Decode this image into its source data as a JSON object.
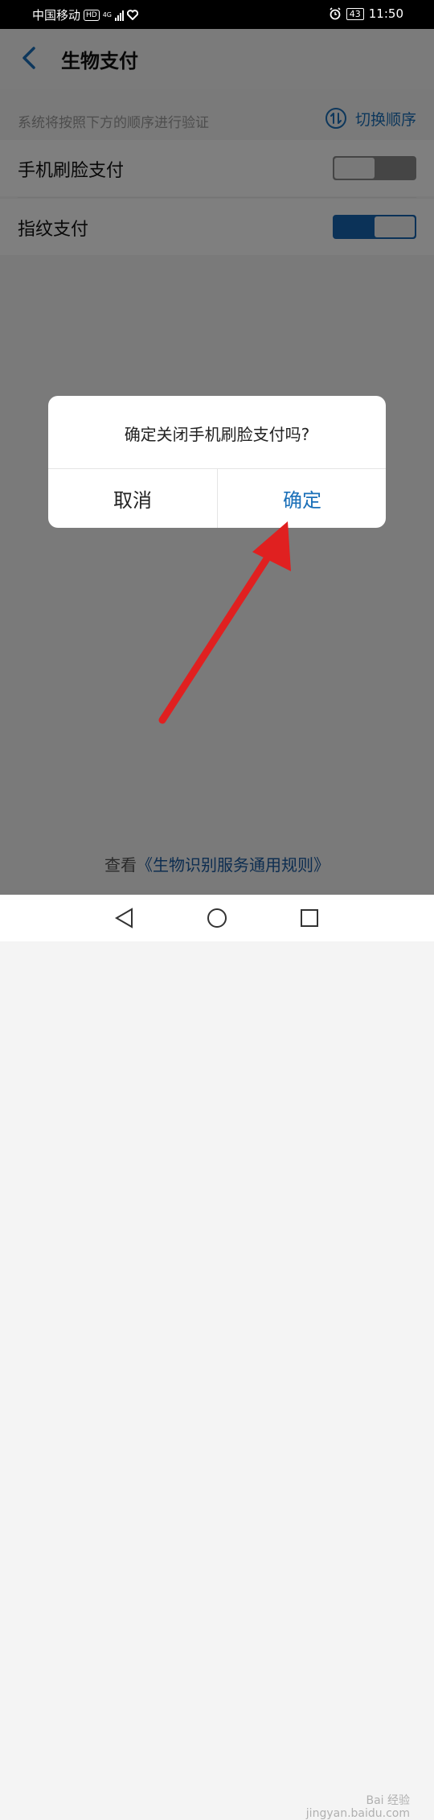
{
  "status_bar": {
    "carrier": "中国移动",
    "hd_label": "HD",
    "network_type": "4G",
    "battery": "43",
    "time": "11:50"
  },
  "header": {
    "title": "生物支付"
  },
  "section": {
    "note": "系统将按照下方的顺序进行验证",
    "switch_order_label": "切换顺序"
  },
  "methods": [
    {
      "label": "手机刷脸支付",
      "enabled": false
    },
    {
      "label": "指纹支付",
      "enabled": true
    }
  ],
  "footer": {
    "prefix": "查看",
    "rule_link": "《生物识别服务通用规则》"
  },
  "dialog": {
    "message": "确定关闭手机刷脸支付吗?",
    "cancel_label": "取消",
    "confirm_label": "确定"
  },
  "watermark": {
    "line1": "Bai 经验",
    "line2": "jingyan.baidu.com"
  },
  "colors": {
    "accent": "#1a6fb8",
    "toggle_on": "#1665b0",
    "arrow": "#e02020"
  }
}
